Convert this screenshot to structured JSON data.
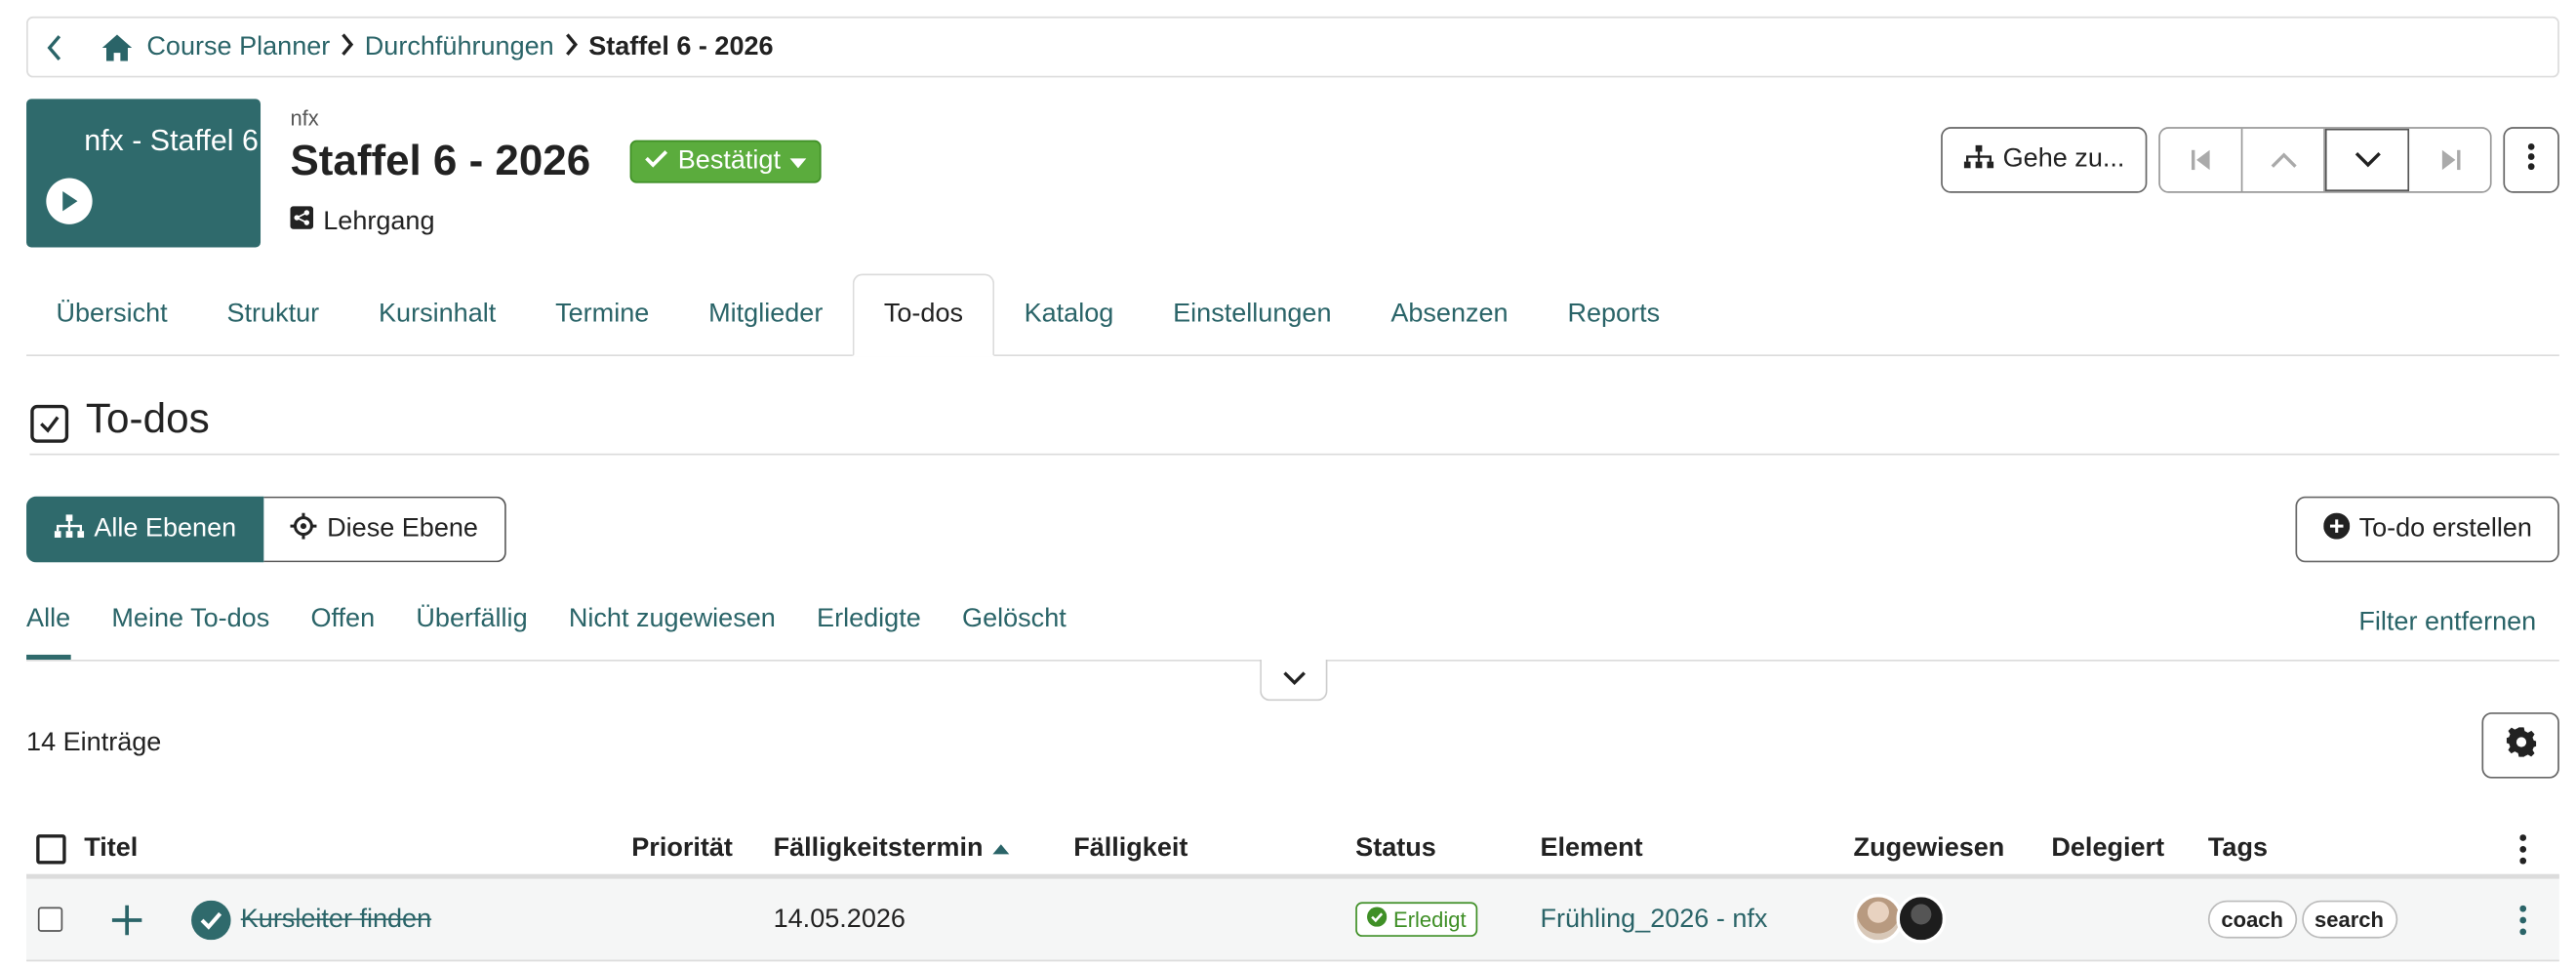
{
  "breadcrumb": {
    "items": [
      "Course Planner",
      "Durchführungen"
    ],
    "current": "Staffel 6 - 2026"
  },
  "course": {
    "tile_text": "nfx - Staffel 6",
    "org": "nfx",
    "title": "Staffel 6 - 2026",
    "status": "Bestätigt",
    "type": "Lehrgang"
  },
  "toolbar": {
    "goto_label": "Gehe zu..."
  },
  "tabs": [
    "Übersicht",
    "Struktur",
    "Kursinhalt",
    "Termine",
    "Mitglieder",
    "To-dos",
    "Katalog",
    "Einstellungen",
    "Absenzen",
    "Reports"
  ],
  "active_tab": "To-dos",
  "section": {
    "title": "To-dos"
  },
  "levels": {
    "all": "Alle Ebenen",
    "this": "Diese Ebene"
  },
  "create_label": "To-do erstellen",
  "filters": {
    "items": [
      "Alle",
      "Meine To-dos",
      "Offen",
      "Überfällig",
      "Nicht zugewiesen",
      "Erledigte",
      "Gelöscht"
    ],
    "clear": "Filter entfernen"
  },
  "entries_count": "14 Einträge",
  "table": {
    "columns": {
      "title": "Titel",
      "priority": "Priorität",
      "due_date": "Fälligkeitstermin",
      "due": "Fälligkeit",
      "status": "Status",
      "element": "Element",
      "assigned": "Zugewiesen",
      "delegated": "Delegiert",
      "tags": "Tags"
    },
    "rows": [
      {
        "title": "Kursleiter finden",
        "due_date": "14.05.2026",
        "status": "Erledigt",
        "element": "Frühling_2026 - nfx",
        "tags": [
          "coach",
          "search"
        ]
      }
    ]
  },
  "colors": {
    "primary": "#2f6a6c",
    "link": "#2a6468",
    "success": "#5bac3d"
  }
}
